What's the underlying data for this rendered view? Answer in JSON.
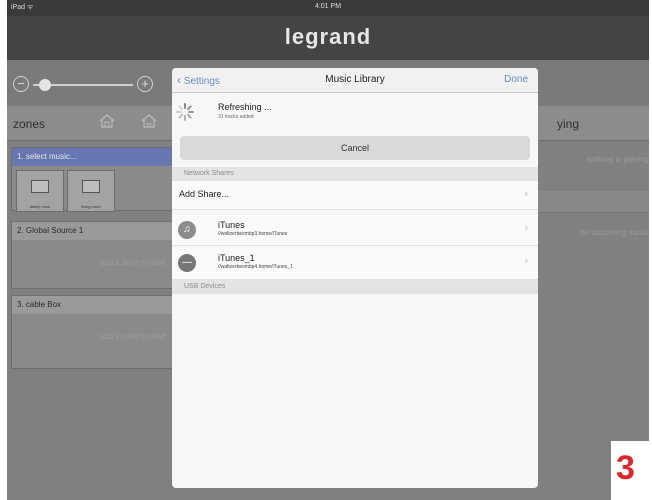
{
  "status": {
    "device": "iPad",
    "time": "4:01 PM"
  },
  "brand": "legrand",
  "volume": {
    "level": 0.06
  },
  "zones_header": {
    "title": "zones"
  },
  "zones": [
    {
      "title": "1. select music...",
      "sources": [
        "family room",
        "living room"
      ]
    },
    {
      "title": "2. Global Source 1",
      "hint": "add a zone to start"
    },
    {
      "title": "3. cable Box",
      "hint": "add a zone to start"
    }
  ],
  "now_playing": {
    "title_visible": "ying",
    "status": "nothing is playing",
    "upcoming": "no upcoming music"
  },
  "modal": {
    "back_label": "Settings",
    "title": "Music Library",
    "done_label": "Done",
    "refresh": {
      "title": "Refreshing ...",
      "subtitle": "31 tracks added"
    },
    "cancel_label": "Cancel",
    "network_header": "Network Shares",
    "add_share": "Add Share...",
    "shares": [
      {
        "name": "iTunes",
        "path": "//waltzerbesmbp3.home/iTunes"
      },
      {
        "name": "iTunes_1",
        "path": "//waltzerbesmbp4.home/iTunes_1"
      }
    ],
    "usb_header": "USB Devices"
  },
  "page_badge": "3",
  "colors": {
    "active_zone": "#6877b2",
    "ios_blue": "#6a8dc5",
    "badge_red": "#d9272e"
  }
}
